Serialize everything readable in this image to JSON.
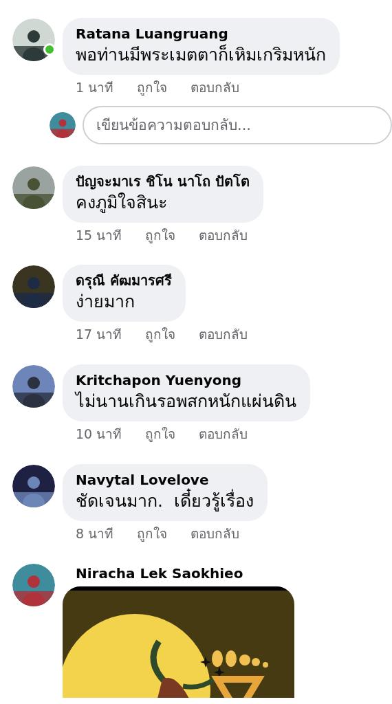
{
  "comments": [
    {
      "kind": "text",
      "author": "Ratana Luangruang",
      "text": "พอท่านมีพระเมตตาก็เหิมเกริมหนัก",
      "online": true,
      "time": "1 นาที",
      "like": "ถูกใจ",
      "reply": "ตอบกลับ",
      "reply_box": {
        "placeholder": "เขียนข้อความตอบกลับ..."
      }
    },
    {
      "kind": "text",
      "author": "ปัญจะมาเร ชิโน นาโถ ปัตโต",
      "text": "คงภูมิใจสินะ",
      "online": false,
      "time": "15 นาที",
      "like": "ถูกใจ",
      "reply": "ตอบกลับ"
    },
    {
      "kind": "text",
      "author": "ดรุณี คัฒมารศรี",
      "text": "ง่ายมาก",
      "online": false,
      "time": "17 นาที",
      "like": "ถูกใจ",
      "reply": "ตอบกลับ"
    },
    {
      "kind": "text",
      "author": "Kritchapon Yuenyong",
      "text": "ไม่นานเกินรอพสกหนักแผ่นดิน",
      "online": false,
      "time": "10 นาที",
      "like": "ถูกใจ",
      "reply": "ตอบกลับ"
    },
    {
      "kind": "text",
      "author": "Navytal Lovelove",
      "text": "ชัดเจนมาก.  เดี๋ยวรู้เรื่อง",
      "online": false,
      "time": "8 นาที",
      "like": "ถูกใจ",
      "reply": "ตอบกลับ"
    },
    {
      "author": "Niracha Lek Saokhieo",
      "online": false
    }
  ]
}
